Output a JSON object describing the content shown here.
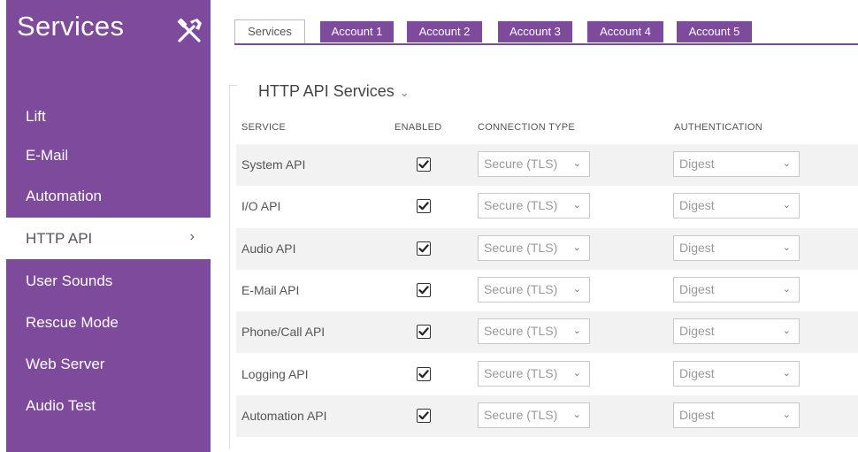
{
  "sidebar": {
    "title": "Services",
    "items": [
      {
        "label": "Lift"
      },
      {
        "label": "E-Mail"
      },
      {
        "label": "Automation"
      },
      {
        "label": "HTTP API",
        "chevron": "›"
      },
      {
        "label": "User Sounds"
      },
      {
        "label": "Rescue Mode"
      },
      {
        "label": "Web Server"
      },
      {
        "label": "Audio Test"
      }
    ]
  },
  "tabs": [
    "Services",
    "Account 1",
    "Account 2",
    "Account 3",
    "Account 4",
    "Account 5"
  ],
  "section": {
    "title": "HTTP API Services",
    "chevron": "⌄"
  },
  "columns": {
    "service": "SERVICE",
    "enabled": "ENABLED",
    "connection": "CONNECTION TYPE",
    "authentication": "AUTHENTICATION"
  },
  "rows": [
    {
      "service": "System API",
      "enabled": true,
      "connection": "Secure (TLS)",
      "auth": "Digest"
    },
    {
      "service": "I/O API",
      "enabled": true,
      "connection": "Secure (TLS)",
      "auth": "Digest"
    },
    {
      "service": "Audio API",
      "enabled": true,
      "connection": "Secure (TLS)",
      "auth": "Digest"
    },
    {
      "service": "E-Mail API",
      "enabled": true,
      "connection": "Secure (TLS)",
      "auth": "Digest"
    },
    {
      "service": "Phone/Call API",
      "enabled": true,
      "connection": "Secure (TLS)",
      "auth": "Digest"
    },
    {
      "service": "Logging API",
      "enabled": true,
      "connection": "Secure (TLS)",
      "auth": "Digest"
    },
    {
      "service": "Automation API",
      "enabled": true,
      "connection": "Secure (TLS)",
      "auth": "Digest"
    }
  ],
  "icons": {
    "tools": "tools-icon",
    "select_arrow": "chevron-down-icon",
    "check": "check-icon"
  },
  "colors": {
    "accent": "#7d4a9c",
    "row_shade": "#f2f2f2"
  }
}
